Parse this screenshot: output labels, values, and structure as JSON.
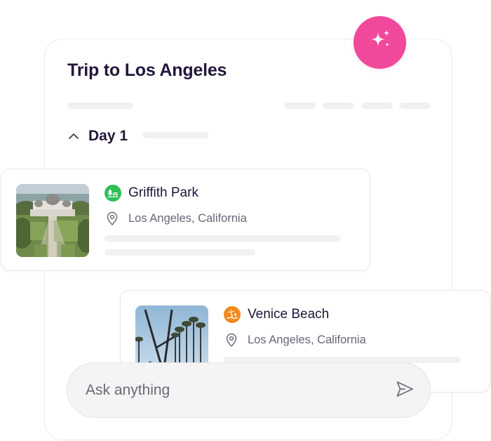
{
  "trip": {
    "title": "Trip to Los Angeles"
  },
  "day": {
    "label": "Day 1",
    "expanded": true
  },
  "places": [
    {
      "name": "Griffith Park",
      "location": "Los Angeles, California",
      "icon": "park-icon",
      "icon_color": "#2fbf59"
    },
    {
      "name": "Venice Beach",
      "location": "Los Angeles, California",
      "icon": "beach-palm-icon",
      "icon_color": "#f28a1c"
    }
  ],
  "chat": {
    "placeholder": "Ask anything",
    "send_icon": "send-icon"
  },
  "ai_button": {
    "icon": "sparkle-icon",
    "color": "#f0499b"
  },
  "colors": {
    "title": "#24173a",
    "skeleton": "#f1f1f4",
    "muted_text": "#6a6478"
  }
}
